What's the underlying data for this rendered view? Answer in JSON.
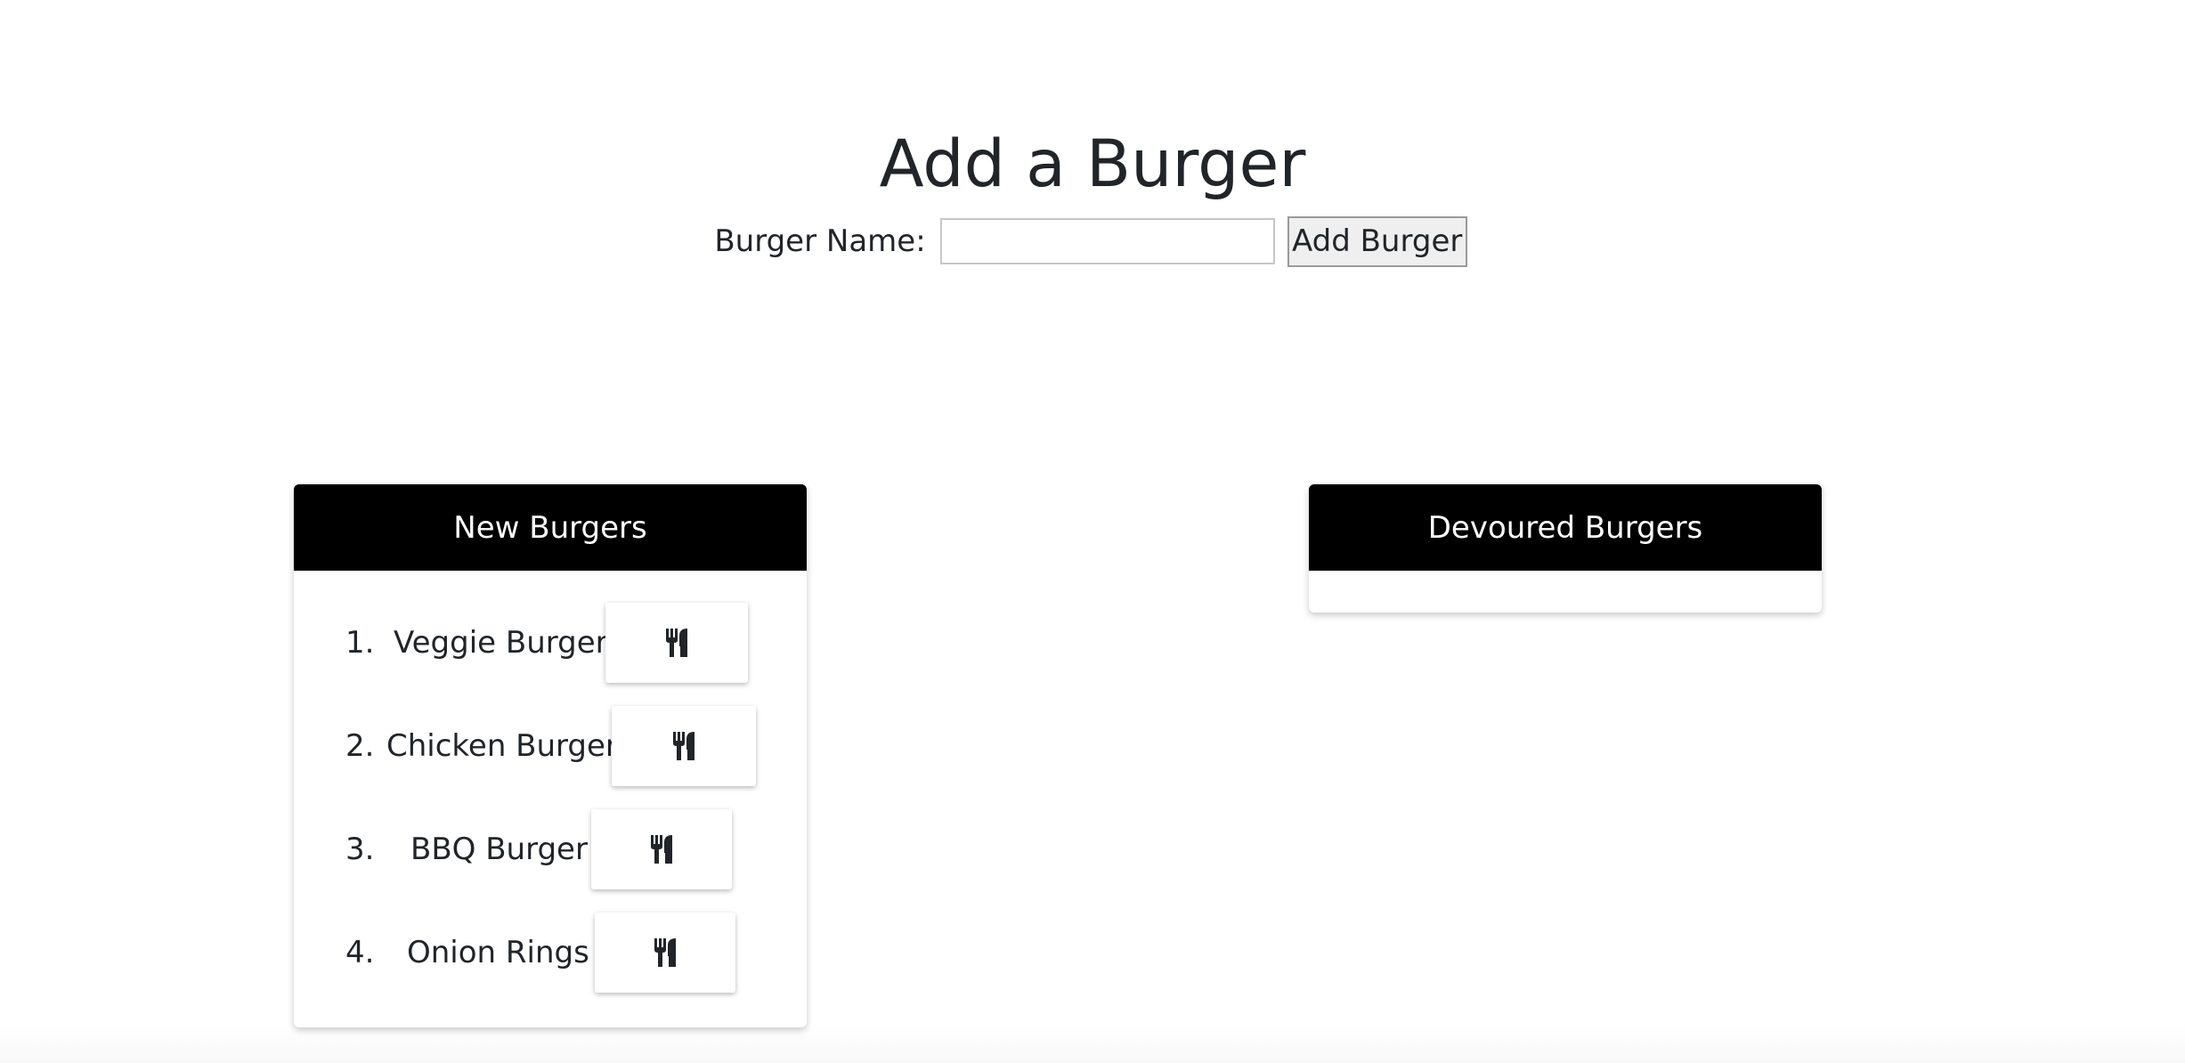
{
  "header": {
    "title": "Add a Burger"
  },
  "add_form": {
    "label": "Burger Name:",
    "input_value": "",
    "button_label": "Add Burger"
  },
  "new_burgers": {
    "title": "New Burgers",
    "items": [
      {
        "number": "1.",
        "name": "Veggie Burger",
        "action_icon": "utensils-icon"
      },
      {
        "number": "2.",
        "name": "Chicken Burger",
        "action_icon": "utensils-icon"
      },
      {
        "number": "3.",
        "name": "BBQ Burger",
        "action_icon": "utensils-icon"
      },
      {
        "number": "4.",
        "name": "Onion Rings",
        "action_icon": "utensils-icon"
      }
    ]
  },
  "devoured_burgers": {
    "title": "Devoured Burgers",
    "items": []
  }
}
